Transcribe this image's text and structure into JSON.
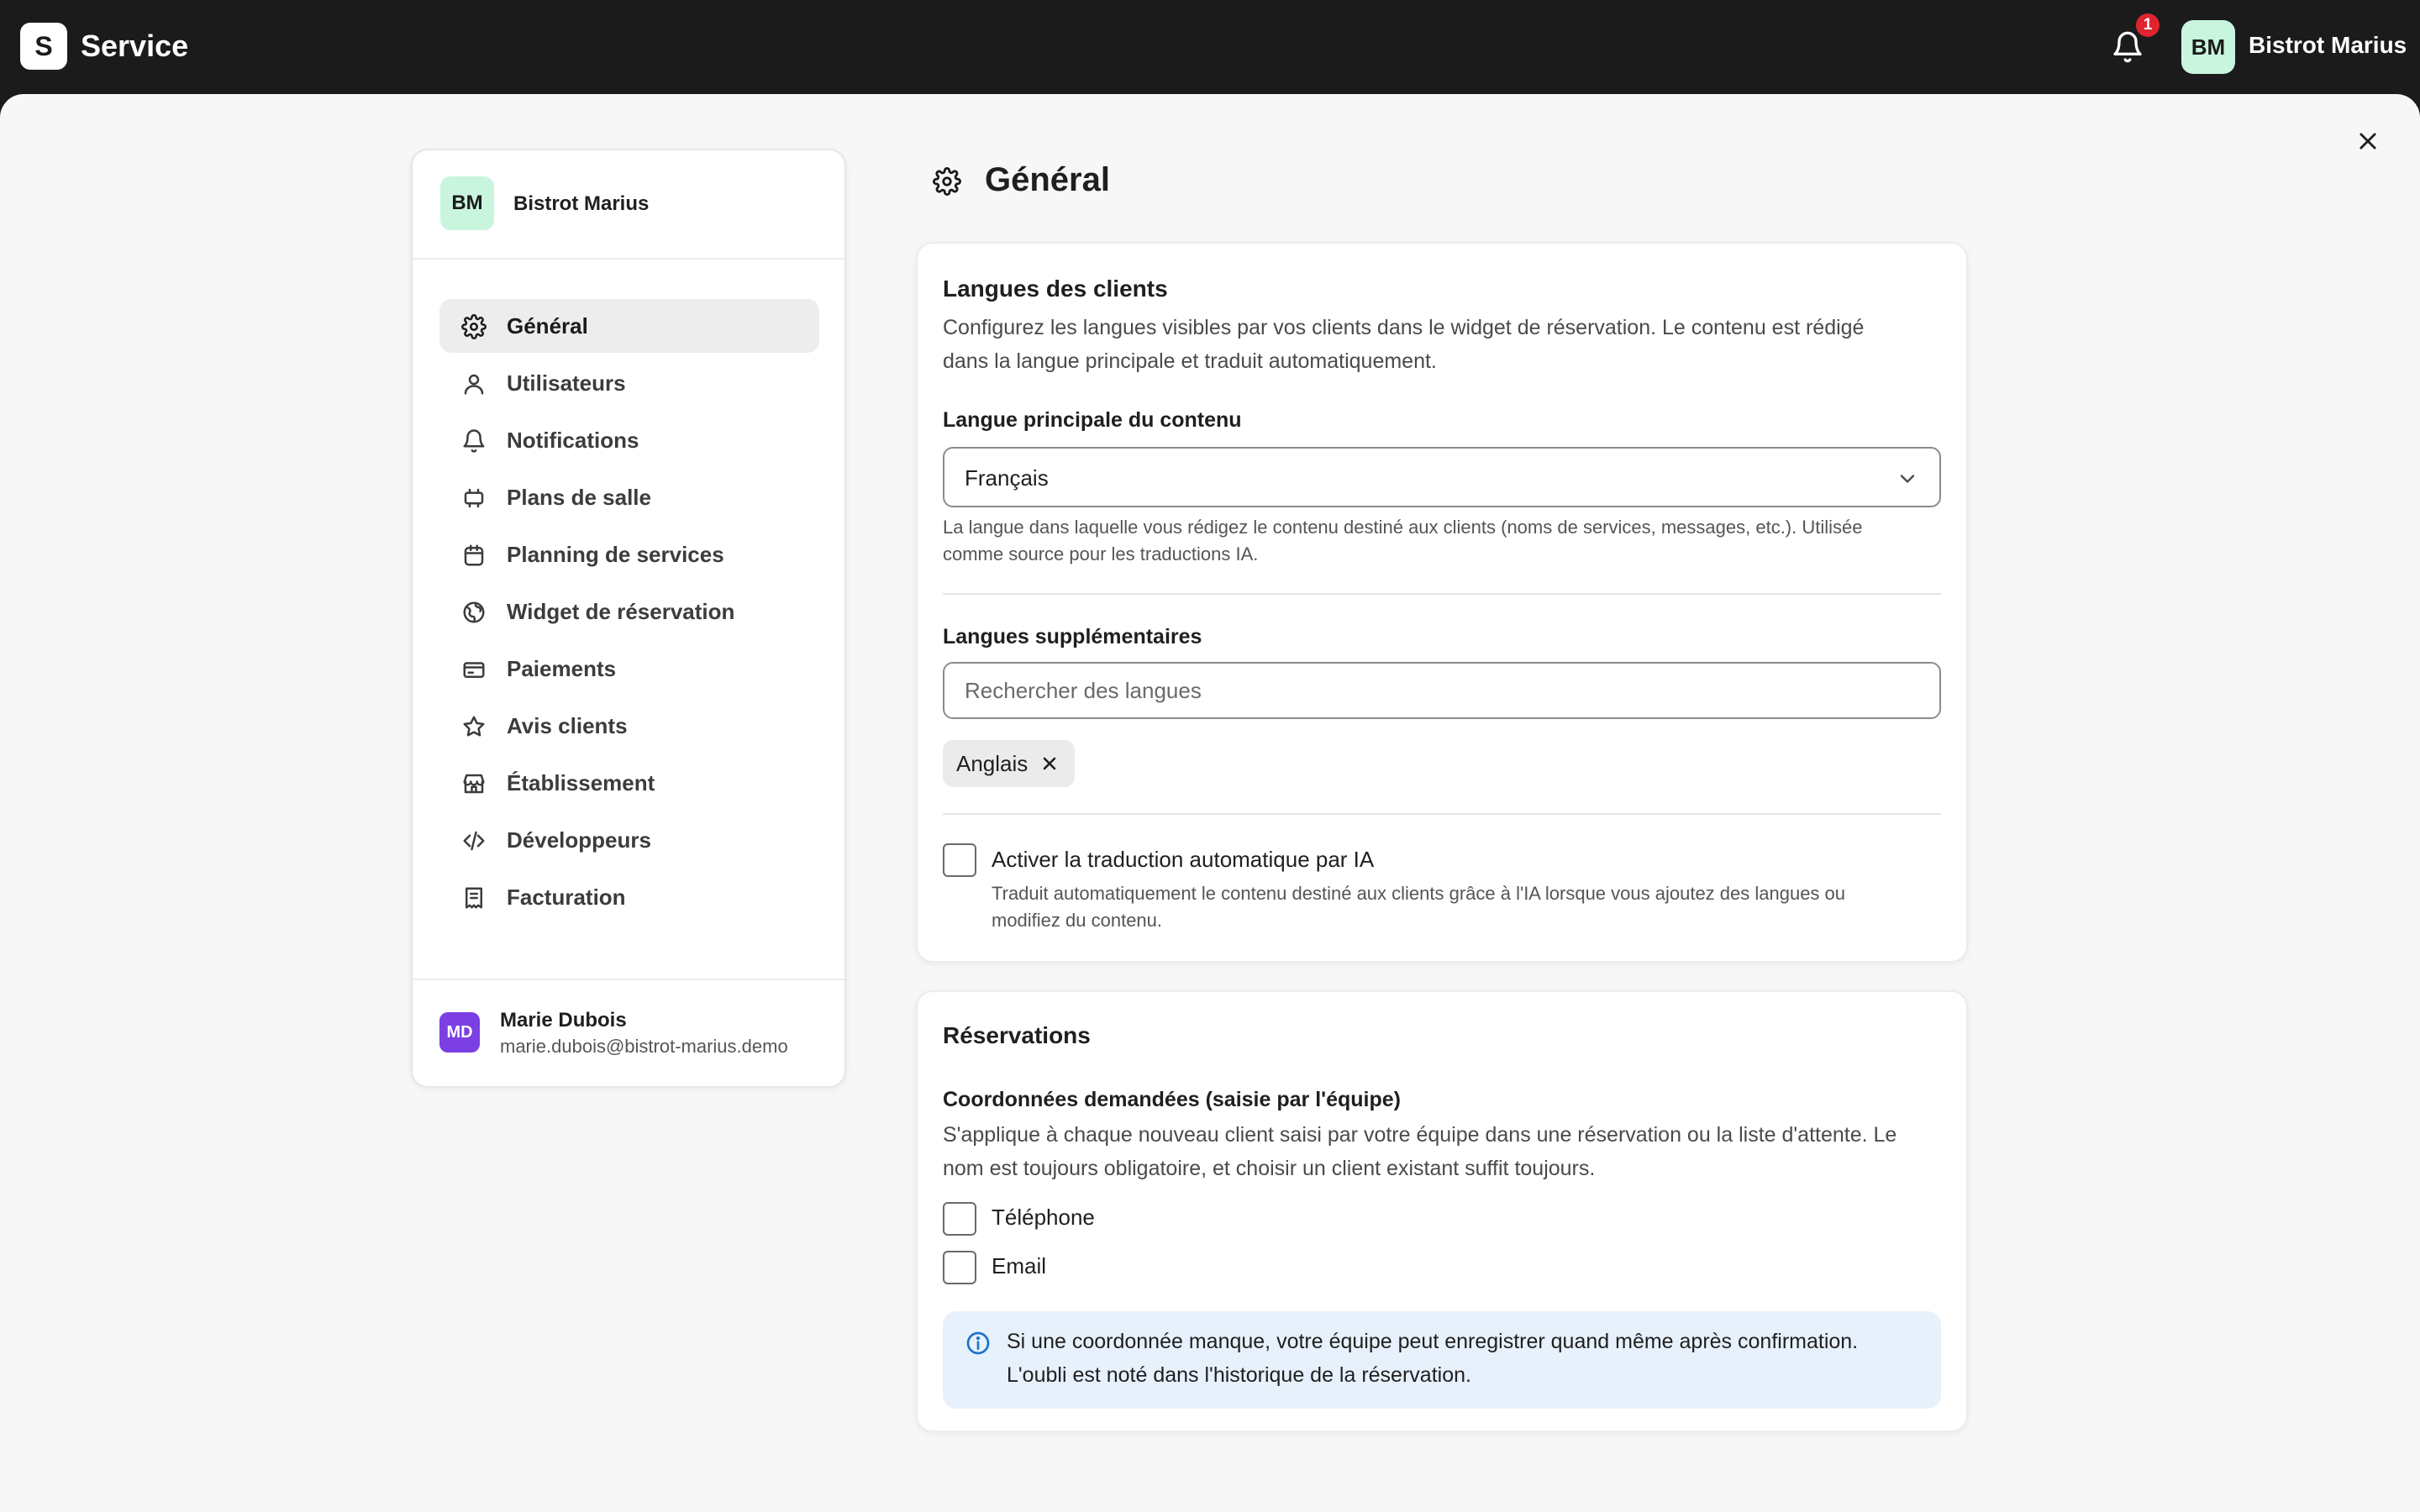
{
  "app": {
    "brand_letter": "S",
    "brand_name": "Service",
    "notification_count": "1",
    "org_initials": "BM",
    "org_name": "Bistrot Marius"
  },
  "sidebar": {
    "org_initials": "BM",
    "org_name": "Bistrot Marius",
    "items": [
      {
        "label": "Général",
        "icon": "gear-icon",
        "active": true
      },
      {
        "label": "Utilisateurs",
        "icon": "user-icon"
      },
      {
        "label": "Notifications",
        "icon": "bell-icon"
      },
      {
        "label": "Plans de salle",
        "icon": "floor-plan-icon"
      },
      {
        "label": "Planning de services",
        "icon": "calendar-icon"
      },
      {
        "label": "Widget de réservation",
        "icon": "globe-icon"
      },
      {
        "label": "Paiements",
        "icon": "credit-card-icon"
      },
      {
        "label": "Avis clients",
        "icon": "star-icon"
      },
      {
        "label": "Établissement",
        "icon": "store-icon"
      },
      {
        "label": "Développeurs",
        "icon": "code-icon"
      },
      {
        "label": "Facturation",
        "icon": "receipt-icon"
      }
    ],
    "user": {
      "initials": "MD",
      "name": "Marie Dubois",
      "email": "marie.dubois@bistrot-marius.demo"
    }
  },
  "page": {
    "title": "Général"
  },
  "languages": {
    "title": "Langues des clients",
    "description_line1": "Configurez les langues visibles par vos clients dans le widget de réservation. Le contenu est rédigé",
    "description_line2": "dans la langue principale et traduit automatiquement.",
    "primary_label": "Langue principale du contenu",
    "primary_value": "Français",
    "primary_hint_line1": "La langue dans laquelle vous rédigez le contenu destiné aux clients (noms de services, messages, etc.). Utilisée",
    "primary_hint_line2": "comme source pour les traductions IA.",
    "extra_label": "Langues supplémentaires",
    "search_placeholder": "Rechercher des langues",
    "chips": [
      "Anglais"
    ],
    "auto_translate_label": "Activer la traduction automatique par IA",
    "auto_translate_hint_line1": "Traduit automatiquement le contenu destiné aux clients grâce à l'IA lorsque vous ajoutez des langues ou",
    "auto_translate_hint_line2": "modifiez du contenu."
  },
  "reservations": {
    "title": "Réservations",
    "contact_label": "Coordonnées demandées (saisie par l'équipe)",
    "contact_desc_line1": "S'applique à chaque nouveau client saisi par votre équipe dans une réservation ou la liste d'attente. Le",
    "contact_desc_line2": "nom est toujours obligatoire, et choisir un client existant suffit toujours.",
    "phone_label": "Téléphone",
    "email_label": "Email",
    "info_line1": "Si une coordonnée manque, votre équipe peut enregistrer quand même après confirmation.",
    "info_line2": "L'oubli est noté dans l'historique de la réservation."
  },
  "colors": {
    "topbar": "#1b1b1b",
    "org_avatar": "#c9f5df",
    "user_avatar": "#7b3fe4",
    "badge": "#e0242f",
    "info_bg": "#e6f1fc",
    "info_icon": "#1a73c9"
  }
}
